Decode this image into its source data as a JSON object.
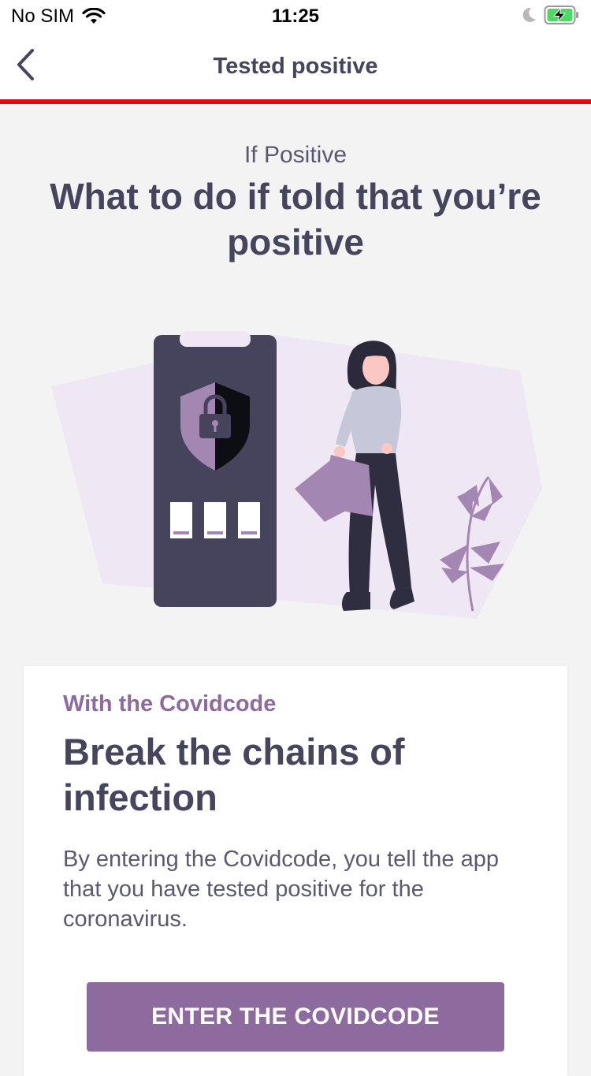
{
  "status_bar": {
    "carrier": "No SIM",
    "time": "11:25",
    "icons": [
      "wifi-icon",
      "moon-icon",
      "battery-charging-icon"
    ]
  },
  "nav": {
    "back_icon": "chevron-left-icon",
    "title": "Tested positive",
    "divider_color": "#e30613"
  },
  "hero": {
    "eyebrow": "If Positive",
    "headline": "What to do if told that you’re positive",
    "illustration": "woman-with-phone-shield-illustration"
  },
  "card": {
    "eyebrow": "With the Covidcode",
    "title": "Break the chains of infection",
    "body": "By entering the Covidcode, you tell the app that you have tested positive for the coronavirus.",
    "button_label": "ENTER THE COVIDCODE"
  },
  "colors": {
    "accent": "#8e6b9e",
    "text_dark": "#46455e",
    "background": "#f3f3f3",
    "brand_red": "#e30613"
  }
}
